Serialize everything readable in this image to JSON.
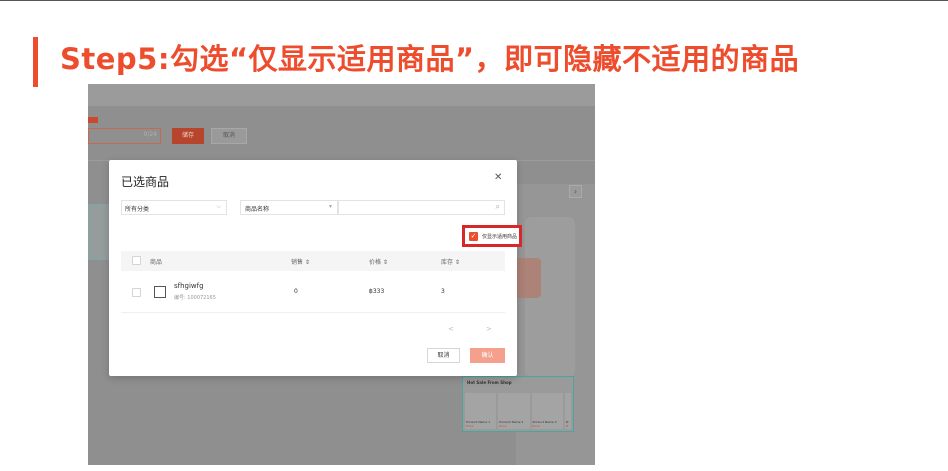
{
  "heading": {
    "text": "Step5:勾选“仅显示适用商品”，即可隐藏不适用的商品",
    "accent_color": "#ee4d2d"
  },
  "background": {
    "badge_icon": "red-badge",
    "input_counter": "0/24",
    "save_label": "储存",
    "cancel_label": "取消",
    "arrow_icon": "chevron-right-icon",
    "hot_sale_title": "Hot Sale From Shop",
    "hot_items": [
      {
        "name": "Product Name 1",
        "price": "Price"
      },
      {
        "name": "Product Name 2",
        "price": "Price"
      },
      {
        "name": "Product Name 3",
        "price": "Price"
      },
      {
        "name": "Pr",
        "price": "Pr"
      }
    ]
  },
  "modal": {
    "title": "已选商品",
    "close_icon": "close-icon",
    "category_select": "所有分类",
    "field_select": "商品名称",
    "search_value": "",
    "filter_checkbox": {
      "label": "仅显示适用商品",
      "checked": true
    },
    "columns": [
      "商品",
      "销售 ⇕",
      "价格 ⇕",
      "库存 ⇕"
    ],
    "rows": [
      {
        "name": "sfhgiwfg",
        "sku": "编号: 100072165",
        "sales": "0",
        "price": "฿333",
        "stock": "3"
      }
    ],
    "pager": {
      "prev": "<",
      "next": ">"
    },
    "cancel_label": "取消",
    "confirm_label": "确认",
    "confirm_color": "#f4a08c"
  }
}
